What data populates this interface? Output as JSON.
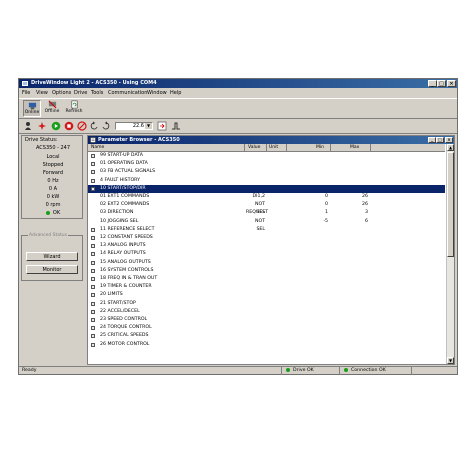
{
  "window": {
    "title": "DriveWindow Light 2 - ACS350 - Using COM4",
    "minimize": "_",
    "maximize": "□",
    "close": "×"
  },
  "menu": [
    "File",
    "View",
    "Options",
    "Drive",
    "Tools",
    "Communication",
    "Window",
    "Help"
  ],
  "toolbar": {
    "online": "Online",
    "offline": "Offline",
    "refresh": "Refresh",
    "reference_value": "22.6"
  },
  "drive_status": {
    "header": "Drive Status:",
    "model": "ACS350 - 247",
    "lines": [
      "Local",
      "Stopped",
      "Forward",
      "0 Hz",
      "0 A",
      "0 kW",
      "0 rpm"
    ],
    "ok": "OK"
  },
  "advanced": {
    "label": "Advanced Status",
    "wizard": "Wizard",
    "monitor": "Monitor"
  },
  "browser": {
    "title": "Parameter Browser - ACS350",
    "columns": {
      "name": "Name",
      "value": "Value",
      "unit": "Unit",
      "min": "Min",
      "max": "Max"
    },
    "rows": [
      {
        "name": "99  START-UP DATA"
      },
      {
        "name": "01  OPERATING DATA"
      },
      {
        "name": "03  FB ACTUAL SIGNALS"
      },
      {
        "name": "4  FAULT HISTORY"
      },
      {
        "name": "10  START/STOP/DIR",
        "selected": true
      },
      {
        "name": "01  EXT1 COMMANDS",
        "value": "DI1,2",
        "min": "0",
        "max": "26",
        "child": true
      },
      {
        "name": "02  EXT2 COMMANDS",
        "value": "NOT SEL",
        "min": "0",
        "max": "26",
        "child": true
      },
      {
        "name": "03  DIRECTION",
        "value": "REQUEST",
        "min": "1",
        "max": "3",
        "child": true
      },
      {
        "name": "10  JOGGING SEL",
        "value": "NOT SEL",
        "min": "-5",
        "max": "6",
        "child": true
      },
      {
        "name": "11  REFERENCE SELECT"
      },
      {
        "name": "12  CONSTANT SPEEDS"
      },
      {
        "name": "13  ANALOG INPUTS"
      },
      {
        "name": "14  RELAY OUTPUTS"
      },
      {
        "name": "15  ANALOG OUTPUTS"
      },
      {
        "name": "16  SYSTEM CONTROLS"
      },
      {
        "name": "18  FREQ IN & TRAN OUT"
      },
      {
        "name": "19  TIMER & COUNTER"
      },
      {
        "name": "20  LIMITS"
      },
      {
        "name": "21  START/STOP"
      },
      {
        "name": "22  ACCEL/DECEL"
      },
      {
        "name": "23  SPEED CONTROL"
      },
      {
        "name": "24  TORQUE CONTROL"
      },
      {
        "name": "25  CRITICAL SPEEDS"
      },
      {
        "name": "26  MOTOR CONTROL"
      }
    ]
  },
  "statusbar": {
    "ready": "Ready",
    "drive": "Drive OK",
    "connection": "Connection OK"
  },
  "colors": {
    "title_start": "#0a246a",
    "title_end": "#3a6ea5",
    "face": "#d4d0c8",
    "ok_green": "#1a9e1a"
  }
}
